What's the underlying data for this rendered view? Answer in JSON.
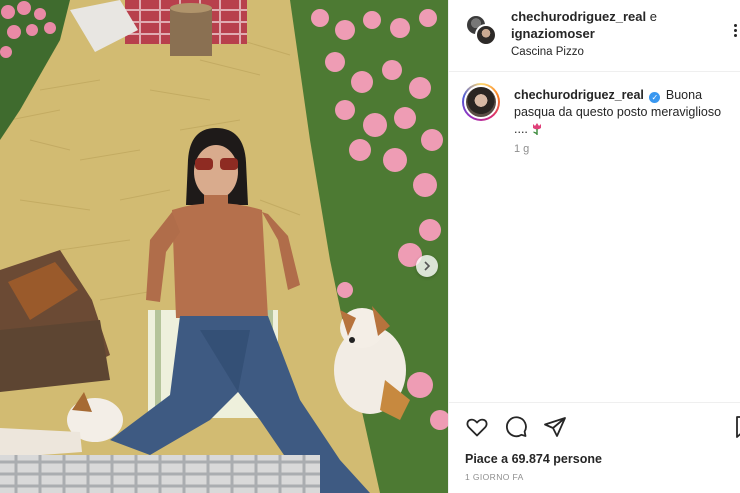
{
  "header": {
    "user1": "chechurodriguez_real",
    "conjunction": "e",
    "user2": "ignaziomoser",
    "location": "Cascina Pizzo"
  },
  "caption": {
    "username": "chechurodriguez_real",
    "text": "Buona pasqua da questo posto meraviglioso ....",
    "emoji_icon": "tulip-icon",
    "time_ago": "1 g"
  },
  "actions": {
    "icons": [
      "heart-icon",
      "comment-icon",
      "share-icon",
      "bookmark-icon"
    ]
  },
  "likes": {
    "prefix": "Piace a",
    "count": "69.874",
    "suffix": "persone"
  },
  "post_date": "1 GIORNO FA",
  "colors": {
    "verified": "#3897f0",
    "text": "#262626",
    "secondary": "#8e8e8e",
    "divider": "#efefef"
  }
}
